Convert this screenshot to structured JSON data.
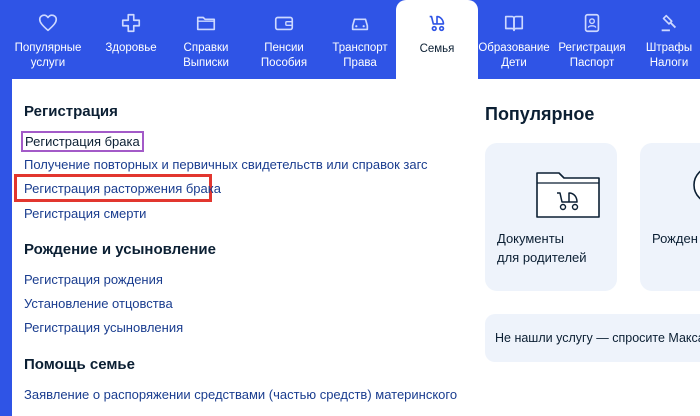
{
  "nav": {
    "items": [
      {
        "line1": "Популярные",
        "line2": "услуги",
        "icon": "heart-icon"
      },
      {
        "line1": "Здоровье",
        "line2": "",
        "icon": "medical-cross-icon"
      },
      {
        "line1": "Справки",
        "line2": "Выписки",
        "icon": "folder-icon"
      },
      {
        "line1": "Пенсии",
        "line2": "Пособия",
        "icon": "wallet-icon"
      },
      {
        "line1": "Транспорт",
        "line2": "Права",
        "icon": "car-icon"
      },
      {
        "line1": "Семья",
        "line2": "",
        "icon": "stroller-icon"
      },
      {
        "line1": "Образование",
        "line2": "Дети",
        "icon": "book-icon"
      },
      {
        "line1": "Регистрация",
        "line2": "Паспорт",
        "icon": "id-card-icon"
      },
      {
        "line1": "Штрафы",
        "line2": "Налоги",
        "icon": "gavel-icon"
      }
    ],
    "active_index": 5,
    "color": "#2f54e6"
  },
  "sections": {
    "registration": {
      "title": "Регистрация",
      "links": [
        "Регистрация брака",
        "Получение повторных и первичных свидетельств или справок загс",
        "Регистрация расторжения брака",
        "Регистрация смерти"
      ]
    },
    "birth": {
      "title": "Рождение и усыновление",
      "links": [
        "Регистрация рождения",
        "Установление отцовства",
        "Регистрация усыновления"
      ]
    },
    "help": {
      "title": "Помощь семье",
      "links": [
        "Заявление о распоряжении средствами (частью средств) материнского"
      ]
    }
  },
  "popular": {
    "title": "Популярное",
    "cards": [
      {
        "line1": "Документы",
        "line2": "для родителей"
      },
      {
        "line1": "Рожден",
        "line2": ""
      }
    ],
    "ask": "Не нашли услугу — спросите Макса"
  },
  "colors": {
    "link": "#1a3d8f",
    "highlight_red": "#e2362f",
    "focus_purple": "#a35ac8"
  }
}
